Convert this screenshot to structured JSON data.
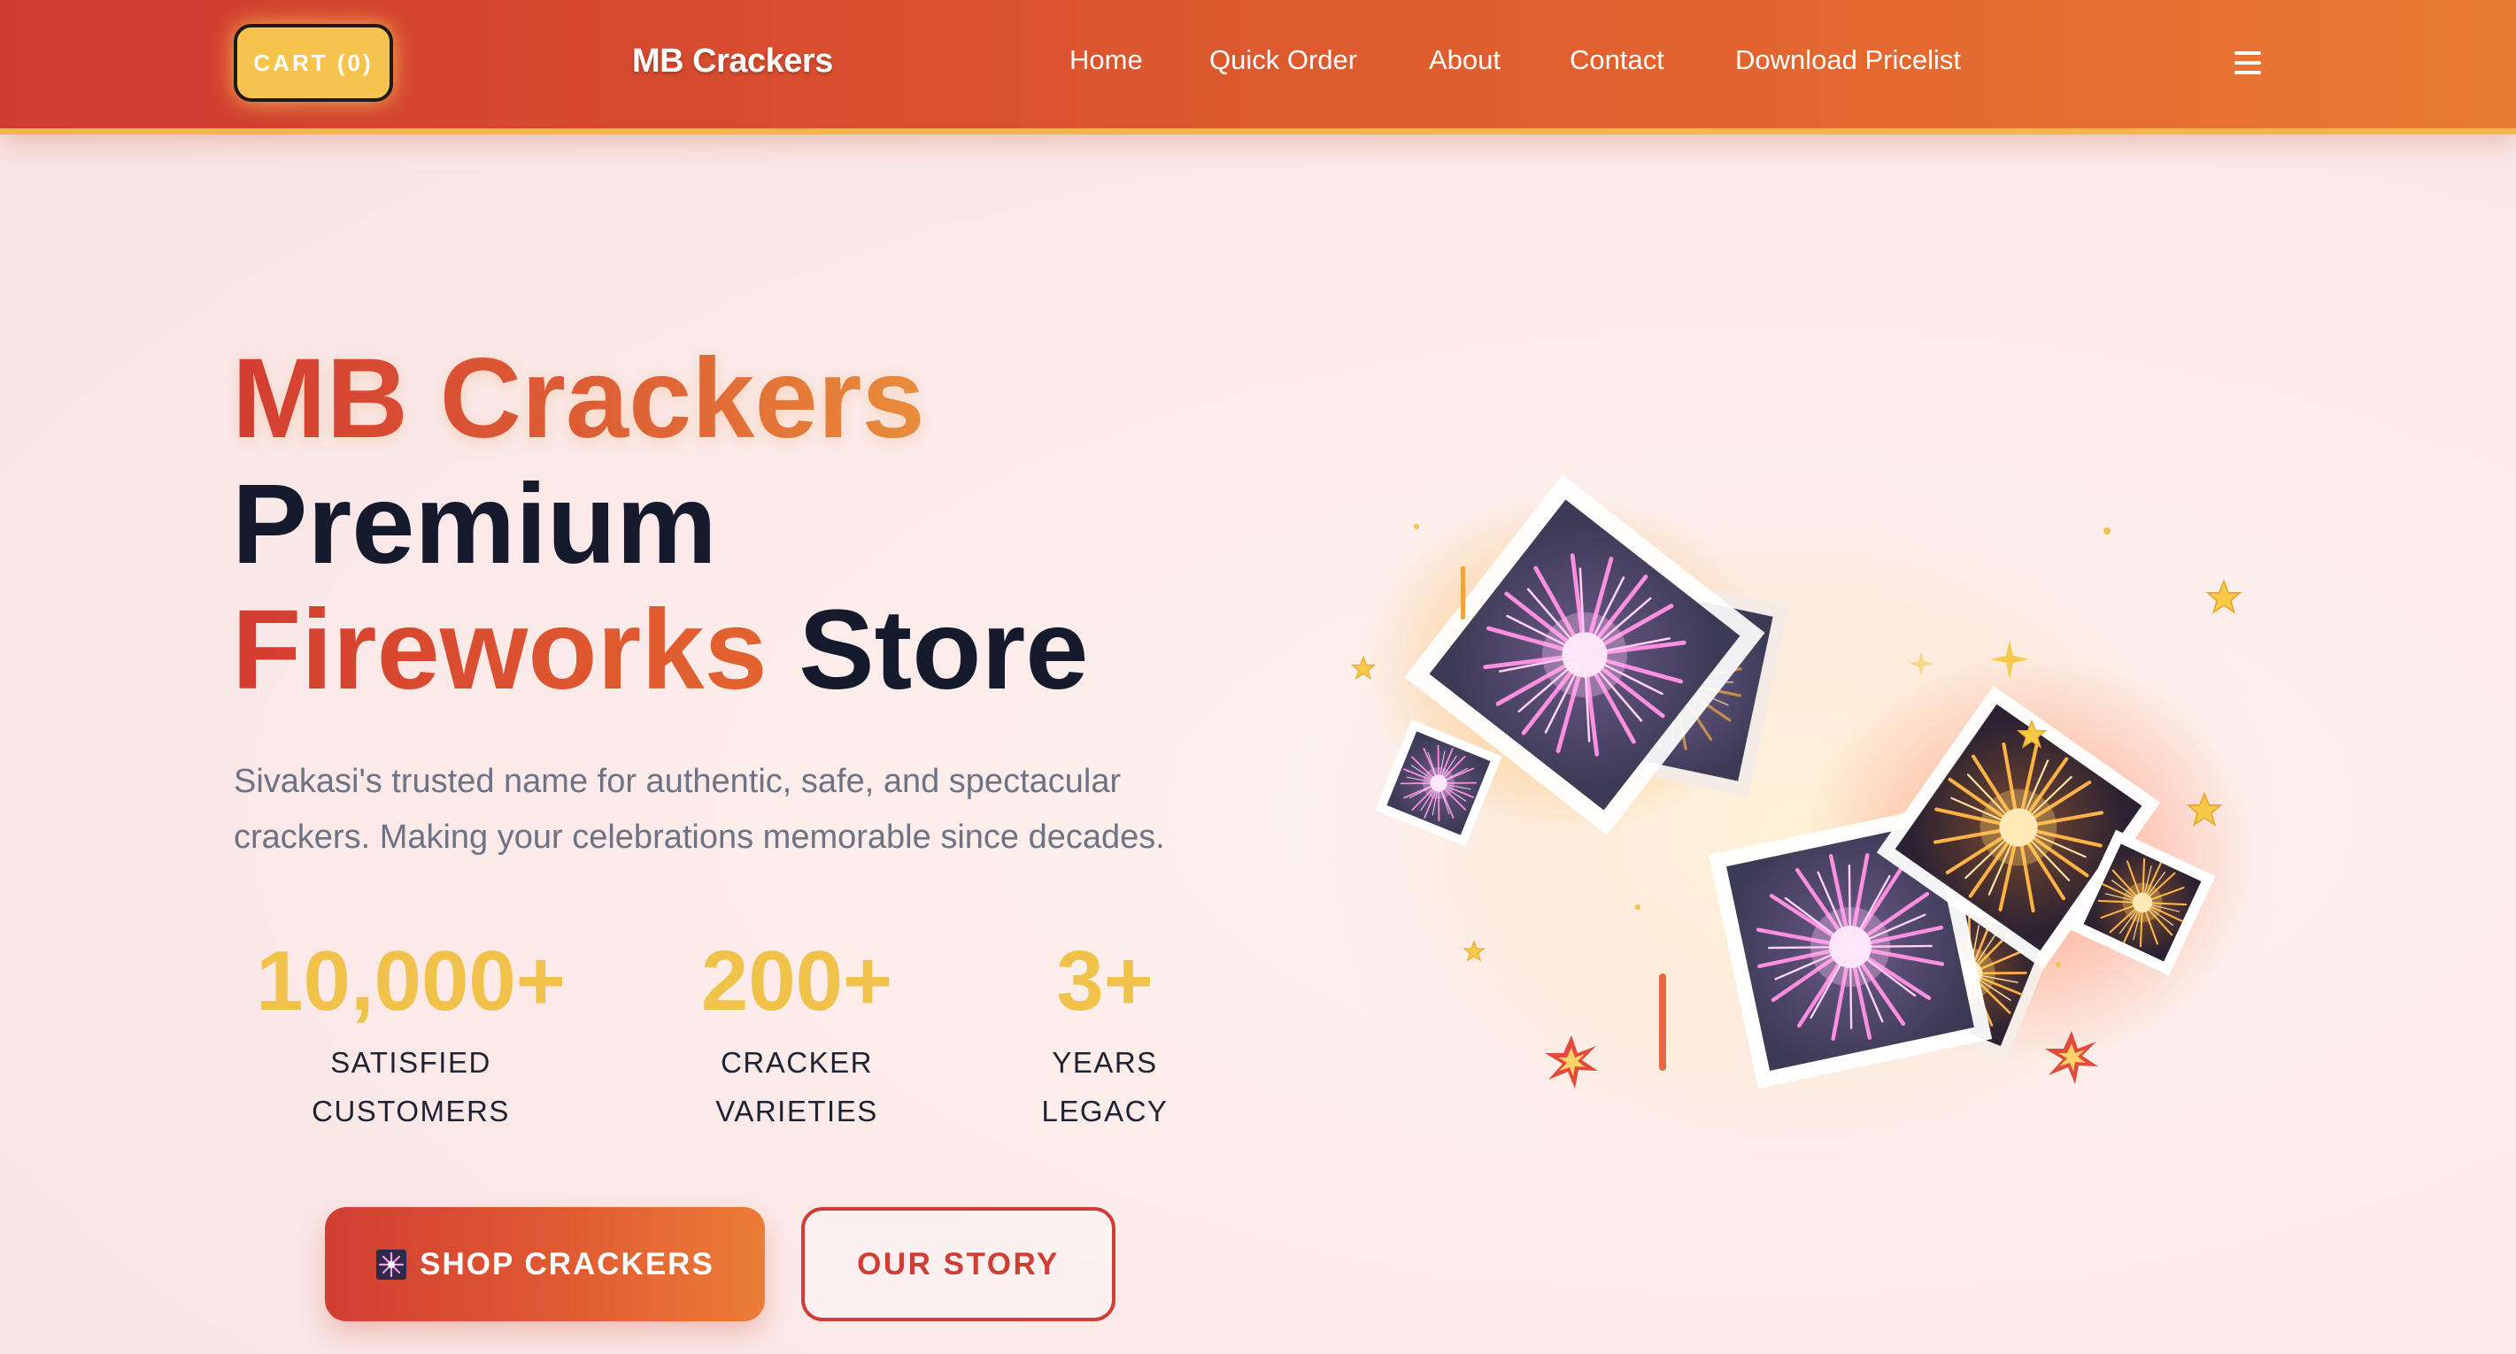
{
  "nav": {
    "cart_label": "CART (0)",
    "brand": "MB Crackers",
    "links": [
      {
        "label": "Home"
      },
      {
        "label": "Quick Order"
      },
      {
        "label": "About"
      },
      {
        "label": "Contact"
      },
      {
        "label": "Download Pricelist"
      }
    ]
  },
  "hero": {
    "title_line1": "MB Crackers",
    "title_line2": "Premium",
    "title_line3_highlight": "Fireworks",
    "title_line3_rest": " Store",
    "description": "Sivakasi's trusted name for authentic, safe, and spectacular crackers. Making your celebrations memorable since decades.",
    "stats": [
      {
        "value": "10,000+",
        "label_line1": "SATISFIED",
        "label_line2": "CUSTOMERS"
      },
      {
        "value": "200+",
        "label_line1": "CRACKER",
        "label_line2": "VARIETIES"
      },
      {
        "value": "3+",
        "label_line1": "YEARS",
        "label_line2": "LEGACY"
      }
    ],
    "primary_button": "SHOP CRACKERS",
    "secondary_button": "OUR STORY"
  },
  "icons": {
    "menu": "hamburger-menu-icon",
    "shop_button": "sparkler-icon"
  },
  "colors": {
    "nav_start": "#cf3b31",
    "nav_end": "#ea7a33",
    "cart_bg": "#f6c34d",
    "stat_value": "#f1c24a",
    "heading_dark": "#151a2d",
    "accent_red": "#cf3d35"
  }
}
